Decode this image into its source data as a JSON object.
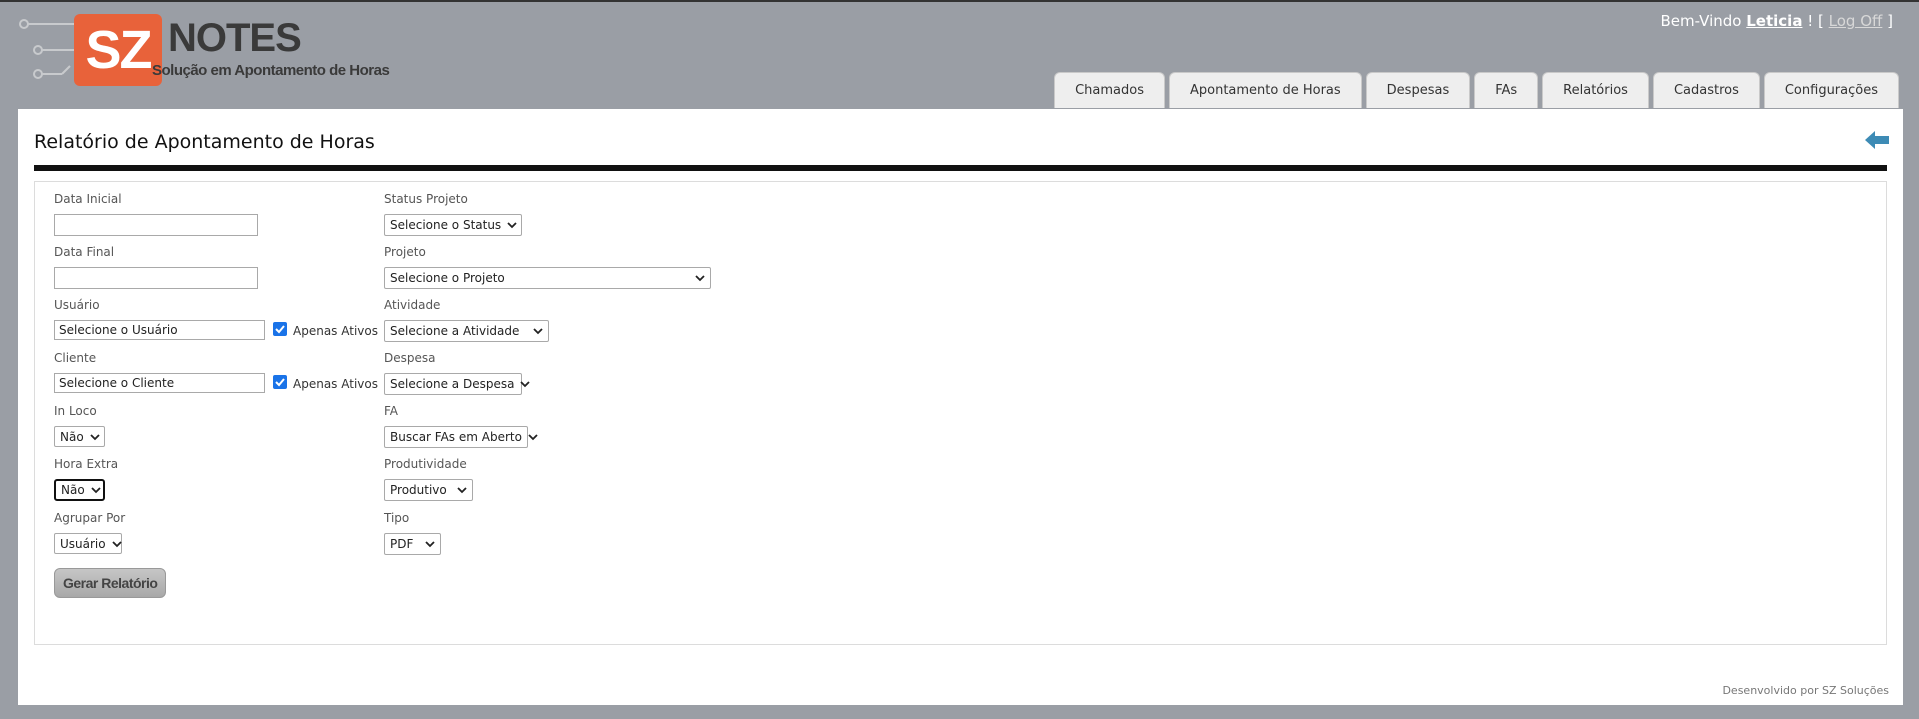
{
  "header": {
    "logo_sz": "SZ",
    "logo_notes": "NOTES",
    "logo_tagline": "Solução em Apontamento de Horas",
    "welcome_prefix": "Bem-Vindo",
    "user_name": "Leticia",
    "welcome_mid": "! [",
    "logoff_label": "Log Off",
    "welcome_suffix": "]"
  },
  "tabs": [
    {
      "label": "Chamados"
    },
    {
      "label": "Apontamento de Horas"
    },
    {
      "label": "Despesas"
    },
    {
      "label": "FAs"
    },
    {
      "label": "Relatórios"
    },
    {
      "label": "Cadastros"
    },
    {
      "label": "Configurações"
    }
  ],
  "page": {
    "title": "Relatório de Apontamento de Horas"
  },
  "form": {
    "data_inicial": {
      "label": "Data Inicial",
      "value": ""
    },
    "data_final": {
      "label": "Data Final",
      "value": ""
    },
    "usuario": {
      "label": "Usuário",
      "value": "Selecione o Usuário",
      "checkbox_label": "Apenas Ativos",
      "checked": true
    },
    "cliente": {
      "label": "Cliente",
      "value": "Selecione o Cliente",
      "checkbox_label": "Apenas Ativos",
      "checked": true
    },
    "in_loco": {
      "label": "In Loco",
      "value": "Não"
    },
    "hora_extra": {
      "label": "Hora Extra",
      "value": "Não"
    },
    "agrupar_por": {
      "label": "Agrupar Por",
      "value": "Usuário"
    },
    "status_projeto": {
      "label": "Status Projeto",
      "value": "Selecione o Status"
    },
    "projeto": {
      "label": "Projeto",
      "value": "Selecione o Projeto"
    },
    "atividade": {
      "label": "Atividade",
      "value": "Selecione a Atividade"
    },
    "despesa": {
      "label": "Despesa",
      "value": "Selecione a Despesa"
    },
    "fa": {
      "label": "FA",
      "value": "Buscar FAs em Aberto"
    },
    "produtividade": {
      "label": "Produtividade",
      "value": "Produtivo"
    },
    "tipo": {
      "label": "Tipo",
      "value": "PDF"
    },
    "submit_label": "Gerar Relatório"
  },
  "footer": {
    "text": "Desenvolvido por SZ Soluções"
  },
  "colors": {
    "background": "#9a9ea5",
    "logo_orange": "#e8623a",
    "checkbox_blue": "#1a73e8",
    "back_arrow": "#3d8bb5"
  }
}
